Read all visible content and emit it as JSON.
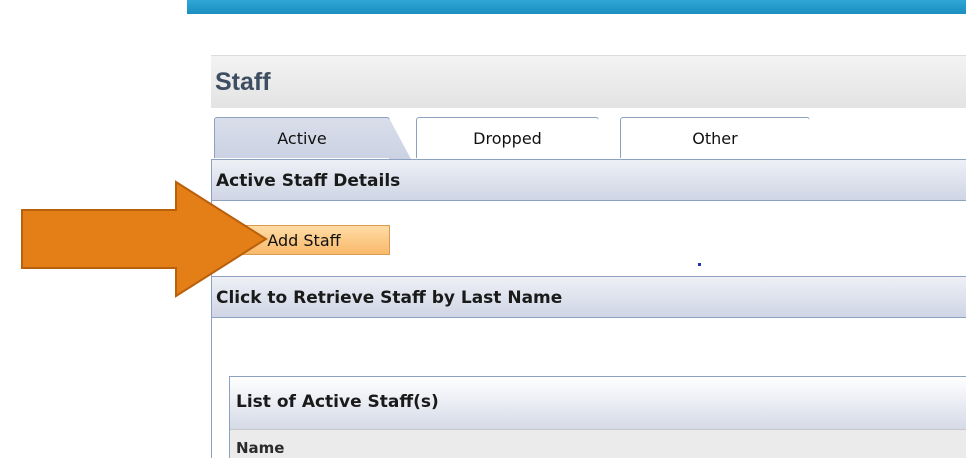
{
  "page": {
    "title": "Staff"
  },
  "tabs": [
    {
      "label": "Active",
      "selected": true
    },
    {
      "label": "Dropped",
      "selected": false
    },
    {
      "label": "Other",
      "selected": false
    }
  ],
  "details_section": {
    "heading": "Active Staff Details",
    "add_button_label": "Add Staff"
  },
  "retrieve_section": {
    "heading": "Click to Retrieve Staff by Last Name"
  },
  "staff_list": {
    "heading": "List of Active Staff(s)",
    "columns": [
      "Name"
    ]
  },
  "annotation": {
    "icon": "arrow-right-icon",
    "color": "#e47e17"
  },
  "colors": {
    "top_bar": "#1b8fbf",
    "title_text": "#3d4d62",
    "button_fill": "#f9b96a",
    "section_header": "#cfd5e5"
  }
}
